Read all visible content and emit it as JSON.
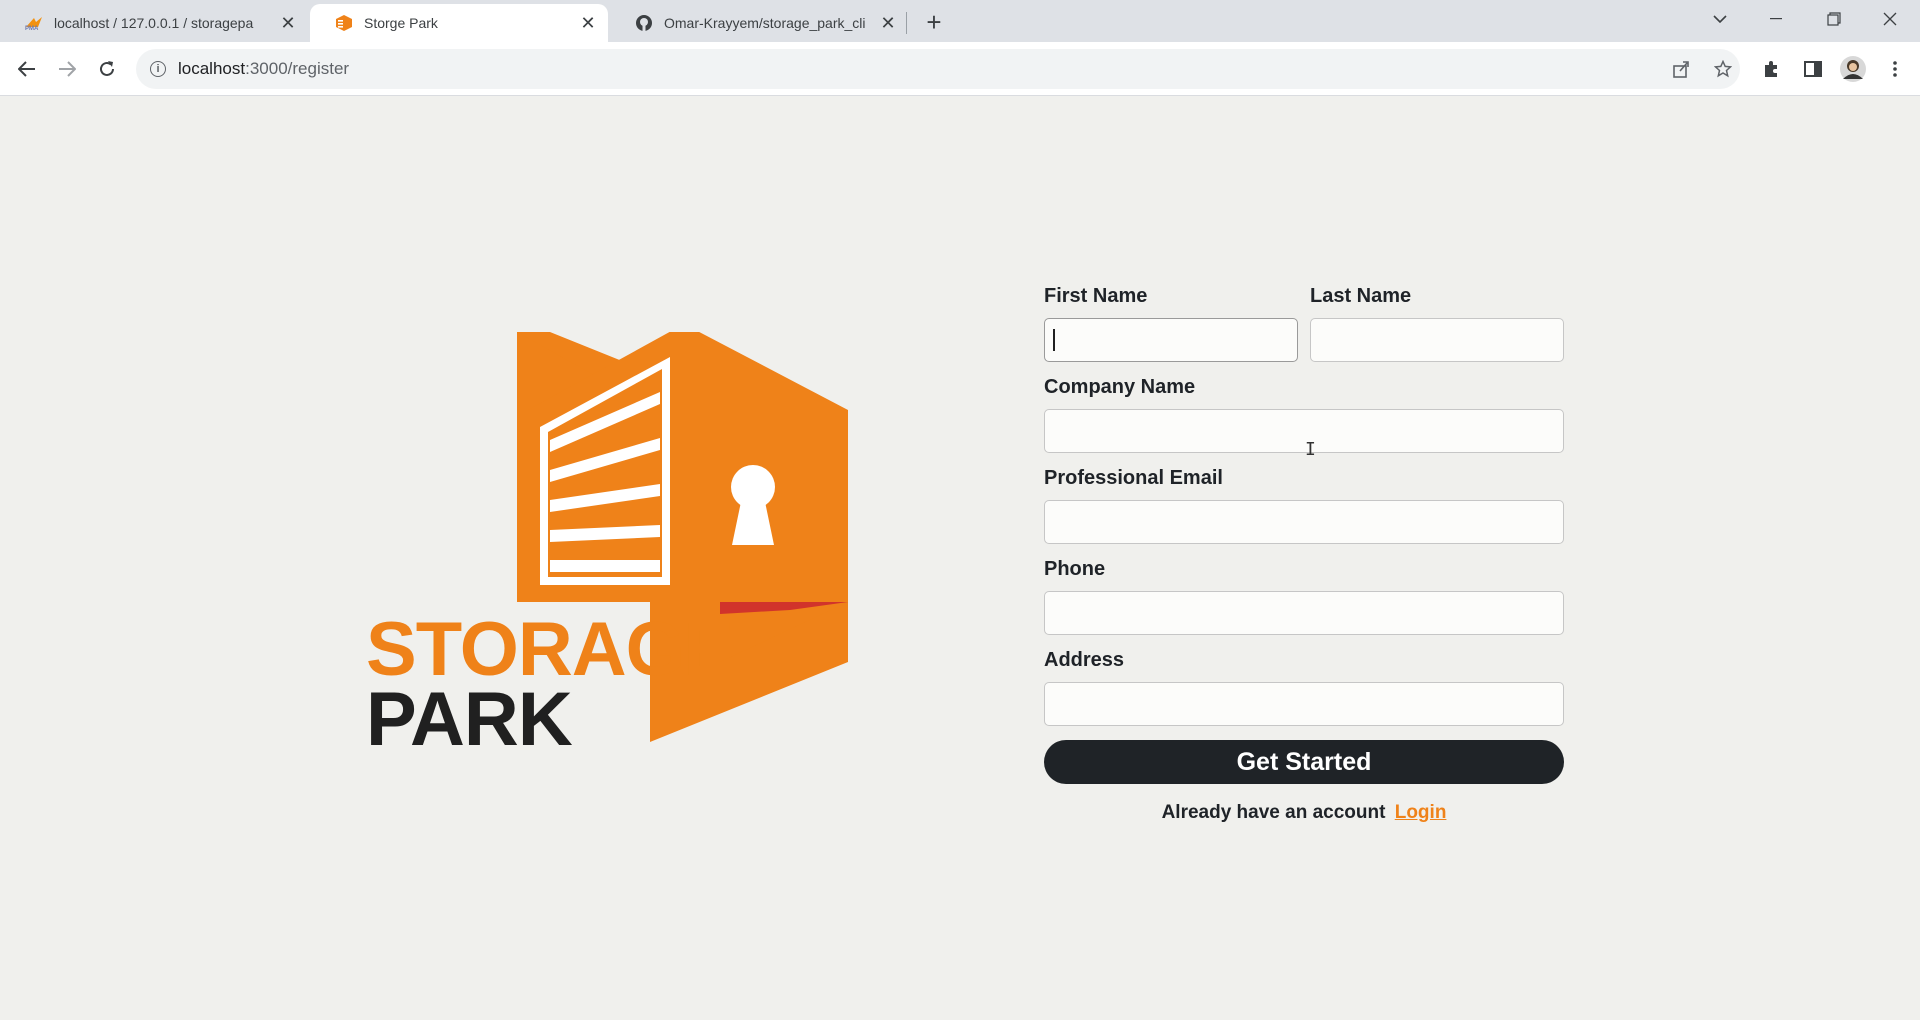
{
  "browser": {
    "tabs": [
      {
        "title": "localhost / 127.0.0.1 / storagepa",
        "icon": "phpmyadmin-icon",
        "active": false
      },
      {
        "title": "Storge Park",
        "icon": "storage-park-favicon",
        "active": true
      },
      {
        "title": "Omar-Krayyem/storage_park_cli",
        "icon": "github-icon",
        "active": false
      }
    ],
    "address": {
      "host": "localhost",
      "path": ":3000/register"
    }
  },
  "logo": {
    "line1": "STORAGE",
    "line2": "PARK",
    "colors": {
      "orange": "#ef8219",
      "dark": "#202020",
      "red": "#d1342b"
    }
  },
  "form": {
    "first_name_label": "First Name",
    "last_name_label": "Last Name",
    "company_label": "Company Name",
    "email_label": "Professional Email",
    "phone_label": "Phone",
    "address_label": "Address",
    "first_name_value": "",
    "last_name_value": "",
    "company_value": "",
    "email_value": "",
    "phone_value": "",
    "address_value": "",
    "submit_label": "Get Started",
    "already_text": "Already have an account",
    "login_link": "Login"
  },
  "colors": {
    "button_bg": "#1f2327",
    "accent": "#ef8219",
    "page_bg": "#f0f0ed"
  }
}
